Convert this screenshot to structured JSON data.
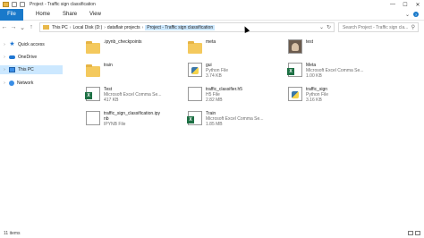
{
  "window": {
    "title": "Project - Traffic sign classification",
    "minimize": "—",
    "maximize": "☐",
    "close": "✕"
  },
  "ribbon": {
    "tabs": [
      "File",
      "Home",
      "Share",
      "View"
    ],
    "expand": "⌄",
    "help": "?"
  },
  "nav": {
    "back": "←",
    "forward": "→",
    "recent": "⌄",
    "up": "↑",
    "breadcrumb": [
      "This PC",
      "Local Disk (D:)",
      "dataflair projects",
      "Project - Traffic sign classification"
    ],
    "dropdown": "⌄",
    "refresh": "↻",
    "search_placeholder": "Search Project - Traffic sign cla..."
  },
  "sidebar": {
    "items": [
      {
        "label": "Quick access",
        "icon": "star-icon"
      },
      {
        "label": "OneDrive",
        "icon": "cloud-icon"
      },
      {
        "label": "This PC",
        "icon": "computer-icon"
      },
      {
        "label": "Network",
        "icon": "network-icon"
      }
    ]
  },
  "files": [
    {
      "name": ".ipynb_checkpoints",
      "type": "",
      "size": "",
      "icon": "folder-icon"
    },
    {
      "name": "meta",
      "type": "",
      "size": "",
      "icon": "folder-icon"
    },
    {
      "name": "test",
      "type": "",
      "size": "",
      "icon": "image-icon"
    },
    {
      "name": "train",
      "type": "",
      "size": "",
      "icon": "folder-icon"
    },
    {
      "name": "gui",
      "type": "Python File",
      "size": "3.74 KB",
      "icon": "python-file-icon"
    },
    {
      "name": "Meta",
      "type": "Microsoft Excel Comma Se...",
      "size": "1.00 KB",
      "icon": "excel-file-icon"
    },
    {
      "name": "Test",
      "type": "Microsoft Excel Comma Se...",
      "size": "417 KB",
      "icon": "excel-file-icon"
    },
    {
      "name": "traffic_classifier.h5",
      "type": "H5 File",
      "size": "2.82 MB",
      "icon": "document-icon"
    },
    {
      "name": "traffic_sign",
      "type": "Python File",
      "size": "3.16 KB",
      "icon": "python-file-icon"
    },
    {
      "name": "traffic_sign_classification.ipynb",
      "type": "IPYNB File",
      "size": "",
      "icon": "document-icon"
    },
    {
      "name": "Train",
      "type": "Microsoft Excel Comma Se...",
      "size": "1.85 MB",
      "icon": "excel-file-icon"
    }
  ],
  "file_name_lines": {
    "ipynb_line1": "traffic_sign_classification.ipy",
    "ipynb_line2": "nb"
  },
  "status": {
    "count": "11 items"
  }
}
